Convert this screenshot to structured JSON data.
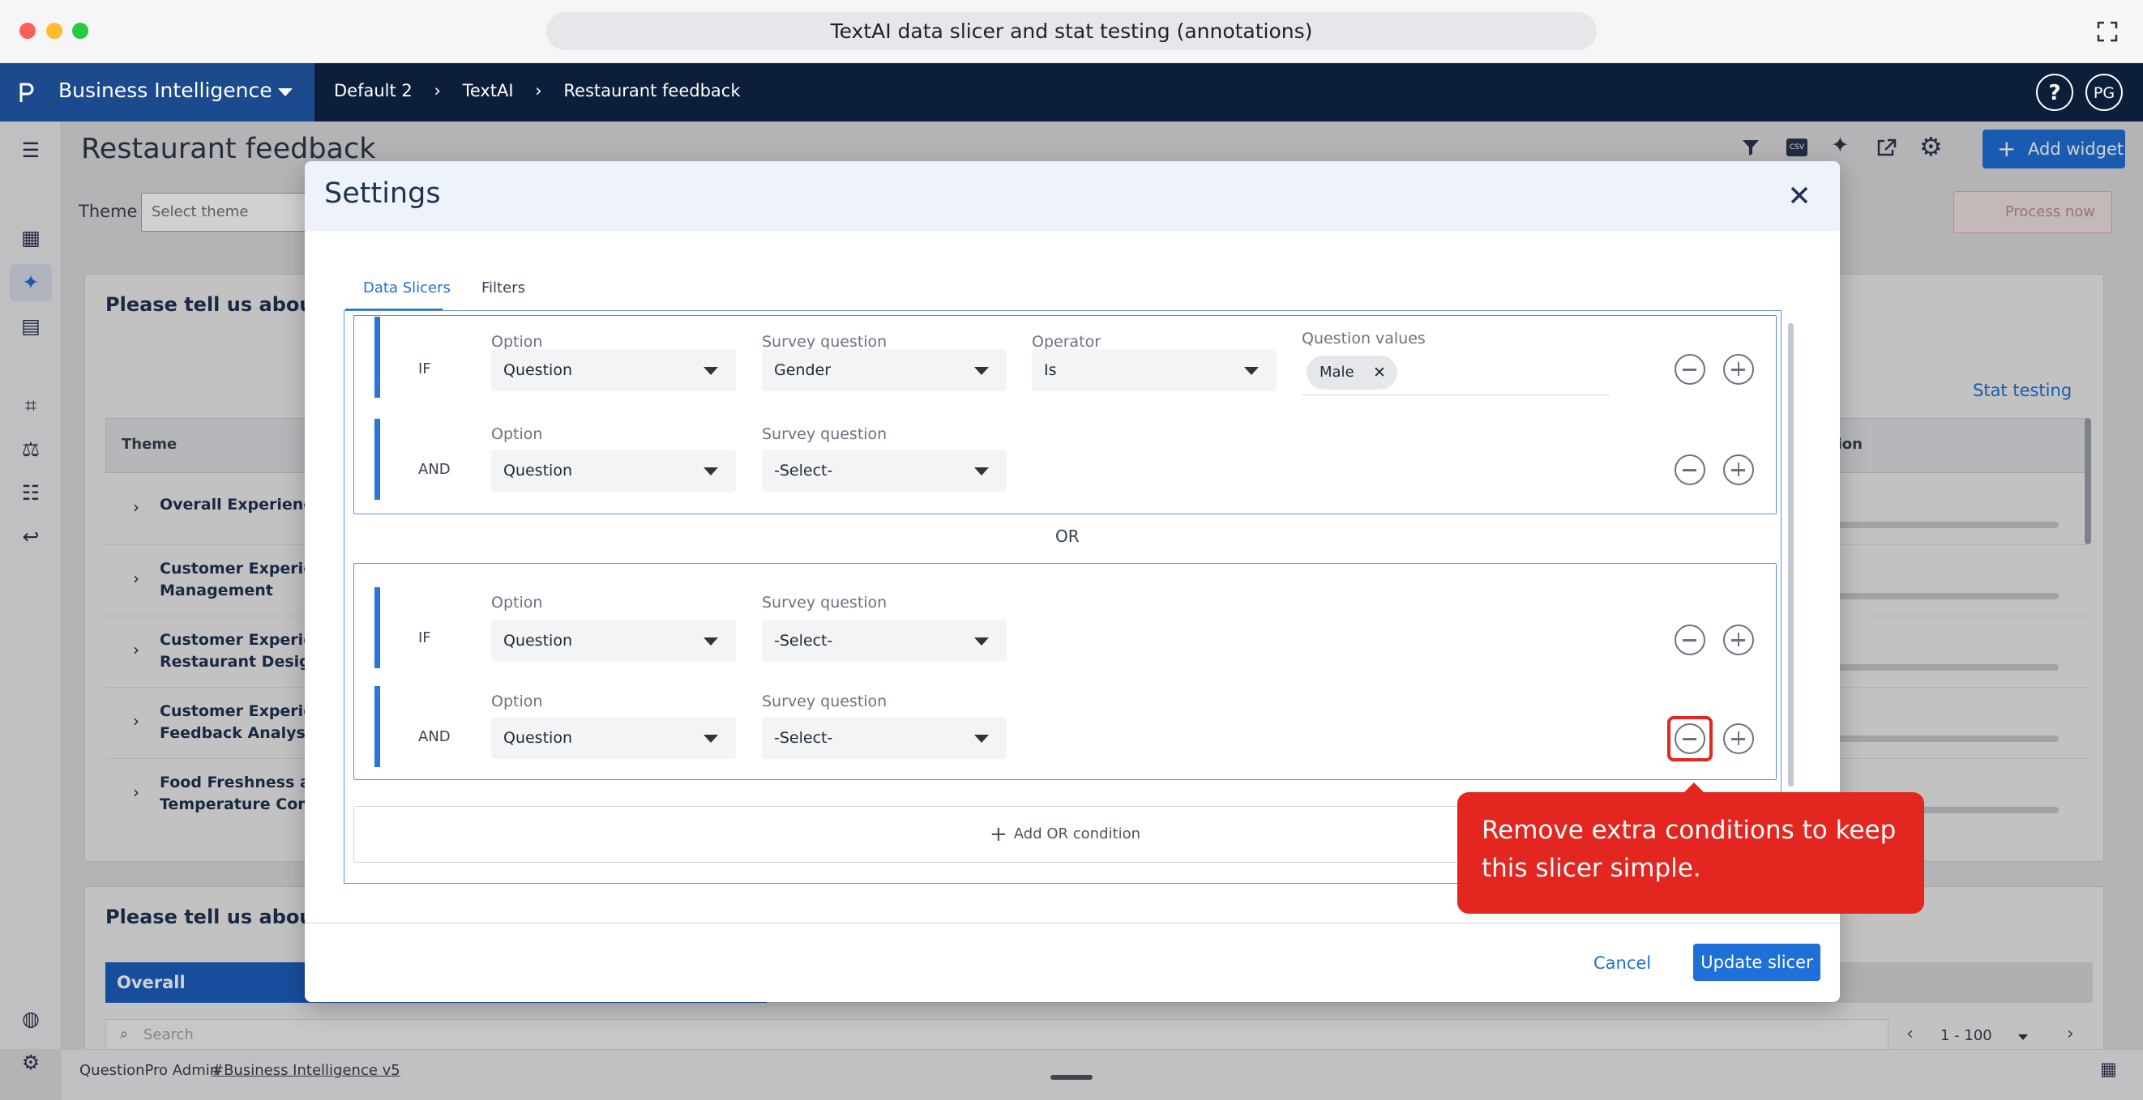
{
  "browser": {
    "title": "TextAI data slicer and stat testing (annotations)"
  },
  "app": {
    "brand": "Business Intelligence",
    "breadcrumb": [
      "Default 2",
      "TextAI",
      "Restaurant feedback"
    ],
    "help": "?",
    "avatar": "PG"
  },
  "page": {
    "title": "Restaurant feedback",
    "add_widget": "Add widget",
    "csv": "CSV",
    "theme_label": "Theme",
    "theme_placeholder": "Select theme",
    "process_now": "Process now",
    "card1_title": "Please tell us about yo",
    "stat_testing": "Stat testing",
    "table_header": "Theme",
    "table_header_right": "tion",
    "themes": [
      "Overall Experience",
      "Customer Experienc\nManagement",
      "Customer Experienc\nRestaurant Design",
      "Customer Experienc\nFeedback Analysis",
      "Food Freshness and\nTemperature Concer"
    ],
    "card2_title": "Please tell us about yo",
    "overall_tab": "Overall",
    "search_placeholder": "Search",
    "pagination": "1 - 100"
  },
  "footer": {
    "admin": "QuestionPro Admin",
    "link": "#Business Intelligence v5"
  },
  "modal": {
    "title": "Settings",
    "tabs": [
      "Data Slicers",
      "Filters"
    ],
    "labels": {
      "option": "Option",
      "survey_question": "Survey question",
      "operator": "Operator",
      "question_values": "Question values"
    },
    "group1": {
      "row1": {
        "cond": "IF",
        "option": "Question",
        "question": "Gender",
        "operator": "Is",
        "chip": "Male"
      },
      "row2": {
        "cond": "AND",
        "option": "Question",
        "question": "-Select-"
      }
    },
    "or_label": "OR",
    "group2": {
      "row1": {
        "cond": "IF",
        "option": "Question",
        "question": "-Select-"
      },
      "row2": {
        "cond": "AND",
        "option": "Question",
        "question": "-Select-"
      }
    },
    "add_or": "Add OR condition",
    "cancel": "Cancel",
    "update": "Update slicer"
  },
  "tooltip": {
    "text": "Remove extra conditions to keep this slicer simple."
  },
  "colors": {
    "primary": "#1f6fd8",
    "header": "#0d1e3b",
    "brand": "#1b4a8e",
    "annotation": "#e3261f"
  }
}
